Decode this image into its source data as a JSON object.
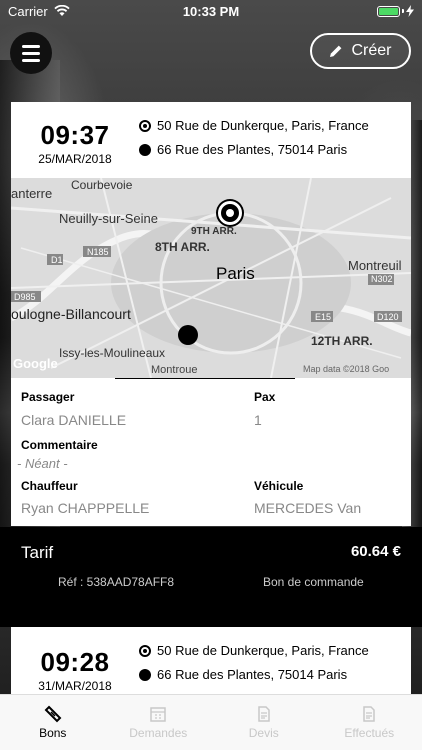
{
  "status_bar": {
    "carrier": "Carrier",
    "time": "10:33 PM",
    "battery_color": "#4cd964"
  },
  "header": {
    "menu_icon": "hamburger-icon",
    "create_label": "Créer",
    "create_icon": "pencil-icon"
  },
  "rides": [
    {
      "time": "09:37",
      "date": "25/MAR/2018",
      "pickup": "50 Rue de Dunkerque, Paris, France",
      "dropoff": "66 Rue des Plantes, 75014 Paris",
      "map": {
        "labels": [
          "Courbevoie",
          "anterre",
          "Neuilly-sur-Seine",
          "9TH ARR.",
          "8TH ARR.",
          "Paris",
          "Montreuil",
          "N302",
          "N185",
          "D1",
          "D985",
          "oulogne-Billancourt",
          "E15",
          "D120",
          "12TH ARR.",
          "Issy-les-Moulineaux",
          "Montroue",
          "Map data ©2018 Goo",
          "Google"
        ]
      },
      "passenger_label": "Passager",
      "passenger": "Clara DANIELLE",
      "pax_label": "Pax",
      "pax": "1",
      "comment_label": "Commentaire",
      "comment": "- Néant -",
      "driver_label": "Chauffeur",
      "driver": "Ryan CHAPPPELLE",
      "vehicle_label": "Véhicule",
      "vehicle": "MERCEDES Van",
      "tarif_label": "Tarif",
      "tarif_amount": "60.64 €",
      "ref": "Réf : 538AAD78AFF8",
      "order_label": "Bon de commande"
    },
    {
      "time": "09:28",
      "date": "31/MAR/2018",
      "pickup": "50 Rue de Dunkerque, Paris, France",
      "dropoff": "66 Rue des Plantes, 75014 Paris"
    }
  ],
  "tabs": [
    {
      "label": "Bons",
      "icon": "ticket-icon",
      "active": true
    },
    {
      "label": "Demandes",
      "icon": "calendar-icon",
      "active": false
    },
    {
      "label": "Devis",
      "icon": "document-icon",
      "active": false
    },
    {
      "label": "Effectués",
      "icon": "document-done-icon",
      "active": false
    }
  ]
}
